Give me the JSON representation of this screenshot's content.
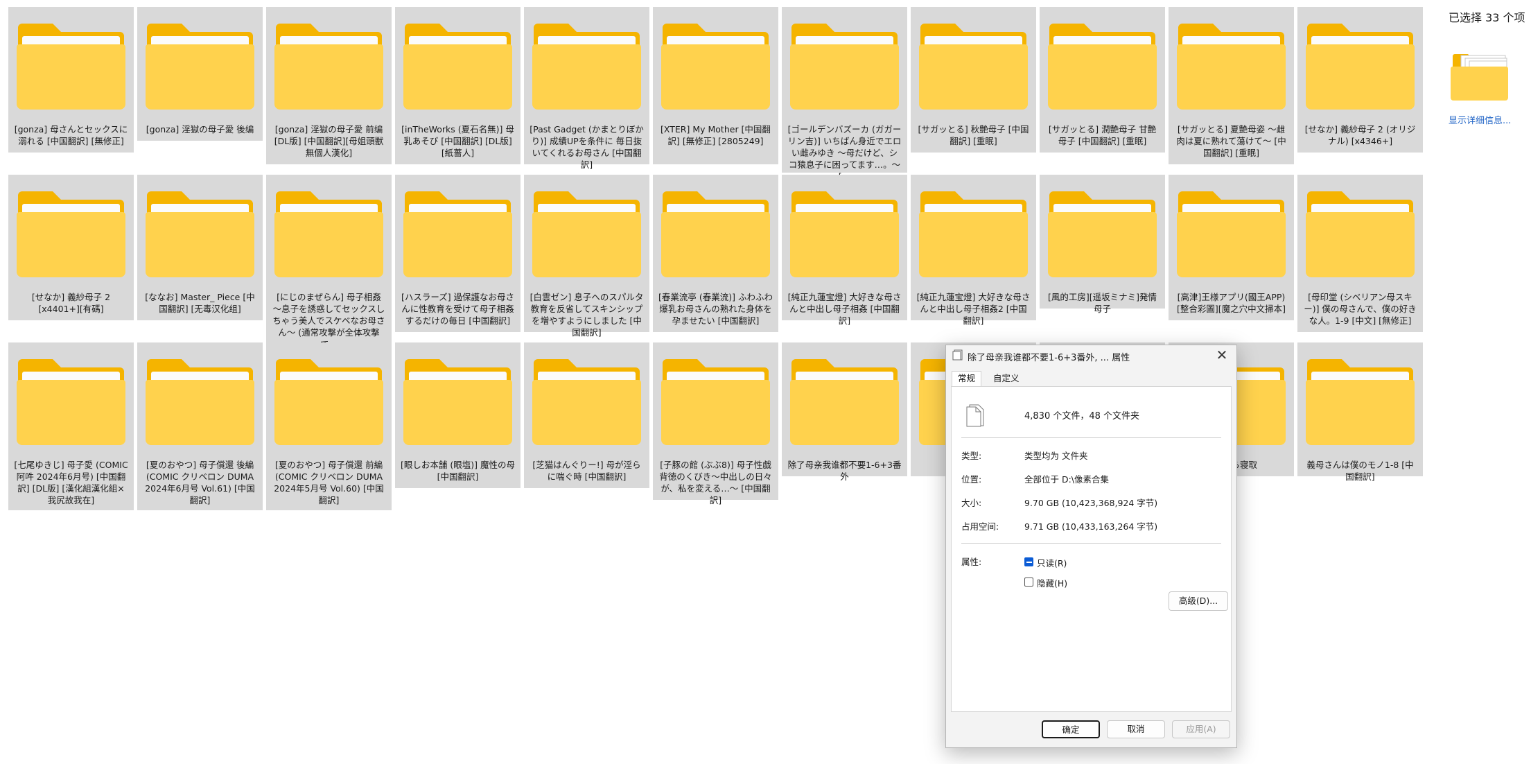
{
  "folders": [
    {
      "label": "[gonza] 母さんとセックスに溺れる [中国翻訳] [無修正]"
    },
    {
      "label": "[gonza] 淫獄の母子愛 後编"
    },
    {
      "label": "[gonza] 淫獄の母子愛 前编 [DL版] [中国翻訳][母姐頭獣無個人漢化]"
    },
    {
      "label": "[inTheWorks (夏石名無)] 母乳あそび [中国翻訳] [DL版] [紙薔人]"
    },
    {
      "label": "[Past Gadget (かまとりぼかり)] 成績UPを条件に 毎日抜いてくれるお母さん [中国翻訳]"
    },
    {
      "label": "[XTER] My Mother [中国翻訳] [無修正] [2805249]"
    },
    {
      "label": "[ゴールデンバズーカ (ガガーリン吉)] いちばん身近でエロい雌みゆき ～母だけど、シコ猿息子に困ってます…。～ […"
    },
    {
      "label": "[サガッとる] 秋艶母子 [中国翻訳] [重眠]"
    },
    {
      "label": "[サガッとる] 潤艶母子 甘艶母子 [中国翻訳] [重眠]"
    },
    {
      "label": "[サガッとる] 夏艶母姿 ～雌肉は夏に熟れて蕩けて～ [中国翻訳] [重眠]"
    },
    {
      "label": "[せなか] 義紗母子 2 (オリジナル) [x4346+]"
    },
    {
      "label": "[せなか] 義紗母子 2 [x4401+][有碼]"
    },
    {
      "label": "[ななお] Master_ Piece [中国翻訳] [无毒汉化组]"
    },
    {
      "label": "[にじのまぜらん] 母子相姦 ～息子を誘惑してセックスしちゃう美人でスケベなお母さん～ (通常攻撃が全体攻撃で…"
    },
    {
      "label": "[ハスラーズ] 過保護なお母さんに性教育を受けて母子相姦するだけの毎日 [中国翻訳]"
    },
    {
      "label": "[白雲ゼン] 息子へのスパルタ教育を反省してスキンシップを増やすようにしました [中国翻訳]"
    },
    {
      "label": "[春業流亭 (春業流)] ふわふわ爆乳お母さんの熟れた身体を孕ませたい [中国翻訳]"
    },
    {
      "label": "[純正九蓮宝燈] 大好きな母さんと中出し母子相姦 [中国翻訳]"
    },
    {
      "label": "[純正九蓮宝燈] 大好きな母さんと中出し母子相姦2 [中国翻訳]"
    },
    {
      "label": "[風的工房][遥坂ミナミ]発情母子"
    },
    {
      "label": "[高津]王様アプリ(國王APP)[整合彩圖][魔之穴中文掃本]"
    },
    {
      "label": "[母印堂 (シベリアン母スキー)] 僕の母さんで、僕の好きな人。1-9 [中文] [無修正]"
    },
    {
      "label": "[七尾ゆきじ] 母子愛 (COMIC阿吽 2024年6月号) [中国翻訳] [DL版] [漢化組漢化組×我尻故我在]"
    },
    {
      "label": "[夏のおやつ] 母子償還 後編 (COMIC クリベロン DUMA 2024年6月号 Vol.61) [中国翻訳]"
    },
    {
      "label": "[夏のおやつ] 母子償還 前編 (COMIC クリベロン DUMA 2024年5月号 Vol.60) [中国翻訳]"
    },
    {
      "label": "[眼しお本舗 (眼塩)] 魔性の母 [中国翻訳]"
    },
    {
      "label": "[芝猫はんぐりー!] 母が淫らに喘ぐ時 [中国翻訳]"
    },
    {
      "label": "[子豚の館 (ぶぶ8)] 母子性戯 背徳のくびき～中出しの日々が、私を変える…～ [中国翻訳]"
    },
    {
      "label": "除了母亲我谁都不要1-6+3番外"
    },
    {
      "label": ""
    },
    {
      "label": ""
    },
    {
      "label": "義父から寝取"
    },
    {
      "label": "義母さんは僕のモノ1-8 [中国翻訳]"
    }
  ],
  "details_pane": {
    "selection_count": "已选择 33 个项",
    "show_details_link": "显示详细信息..."
  },
  "dialog": {
    "title": "除了母亲我谁都不要1-6+3番外, ... 属性",
    "close_glyph": "✕",
    "tabs": [
      {
        "label": "常规"
      },
      {
        "label": "自定义"
      }
    ],
    "file_count": "4,830 个文件，48 个文件夹",
    "properties": {
      "type_label": "类型:",
      "type_value": "类型均为 文件夹",
      "location_label": "位置:",
      "location_value": "全部位于 D:\\像素合集",
      "size_label": "大小:",
      "size_value": "9.70 GB (10,423,368,924 字节)",
      "disk_label": "占用空间:",
      "disk_value": "9.71 GB (10,433,163,264 字节)",
      "attr_label": "属性:"
    },
    "readonly_label": "只读(R)",
    "readonly_checked": true,
    "hidden_label": "隐藏(H)",
    "hidden_checked": false,
    "advanced_label": "高级(D)...",
    "ok_label": "确定",
    "cancel_label": "取消",
    "apply_label": "应用(A)"
  },
  "colors": {
    "tile_selected": "#d9d9d9",
    "folder_front": "#ffd24d",
    "folder_back": "#f5b400",
    "link": "#1f63c6",
    "accent": "#0b5cd5"
  }
}
